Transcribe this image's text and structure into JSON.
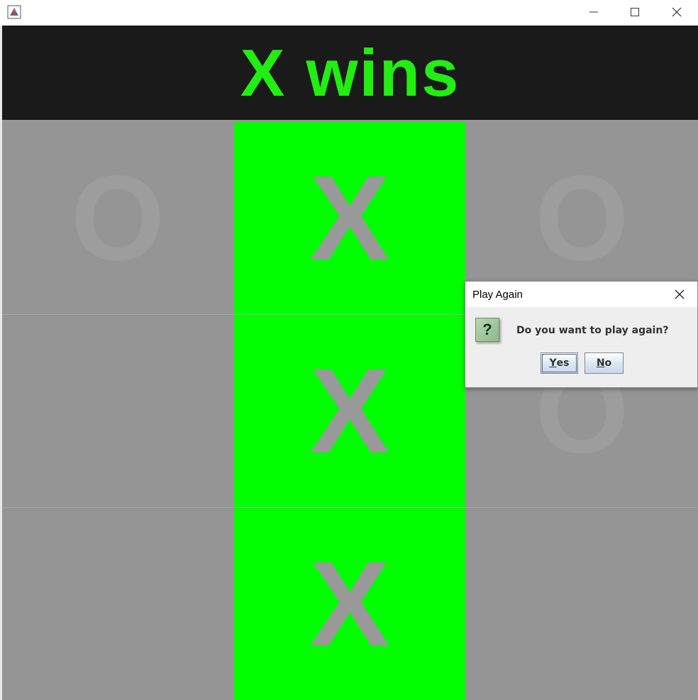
{
  "window": {
    "controls": {
      "minimize_icon": "minimize-icon",
      "maximize_icon": "maximize-icon",
      "close_icon": "close-icon"
    }
  },
  "header": {
    "status_text": "X wins",
    "text_color": "#22ee11",
    "background": "#1a1a1a"
  },
  "board": {
    "cells": [
      {
        "mark": "O",
        "winning": false
      },
      {
        "mark": "X",
        "winning": true
      },
      {
        "mark": "O",
        "winning": false
      },
      {
        "mark": "",
        "winning": false
      },
      {
        "mark": "X",
        "winning": true
      },
      {
        "mark": "O",
        "winning": false
      },
      {
        "mark": "",
        "winning": false
      },
      {
        "mark": "X",
        "winning": true
      },
      {
        "mark": "",
        "winning": false
      }
    ],
    "win_color": "#00ff00",
    "cell_color": "#959595"
  },
  "dialog": {
    "title": "Play Again",
    "message": "Do you want to play again?",
    "icon": "question-icon",
    "yes_mnemonic": "Y",
    "yes_rest": "es",
    "no_mnemonic": "N",
    "no_rest": "o"
  }
}
